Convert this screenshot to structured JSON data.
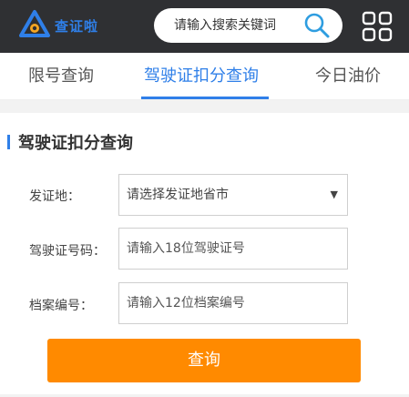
{
  "header": {
    "logo_text": "查证啦",
    "search_placeholder": "请输入搜索关键词",
    "background_color": "#2f3033",
    "accent_color": "#2f7fe8",
    "icons": [
      "logo-icon",
      "search-icon",
      "grid-menu-icon"
    ]
  },
  "tabs": [
    {
      "label": "限号查询",
      "active": false
    },
    {
      "label": "驾驶证扣分查询",
      "active": true
    },
    {
      "label": "今日油价",
      "active": false
    }
  ],
  "form": {
    "title": "驾驶证扣分查询",
    "fields": [
      {
        "label": "发证地：",
        "type": "select",
        "value": "请选择发证地省市"
      },
      {
        "label": "驾驶证号码：",
        "type": "text",
        "placeholder": "请输入18位驾驶证号"
      },
      {
        "label": "档案编号：",
        "type": "text",
        "placeholder": "请输入12位档案编号"
      }
    ],
    "submit_label": "查询",
    "submit_color": "#ff8a00"
  }
}
